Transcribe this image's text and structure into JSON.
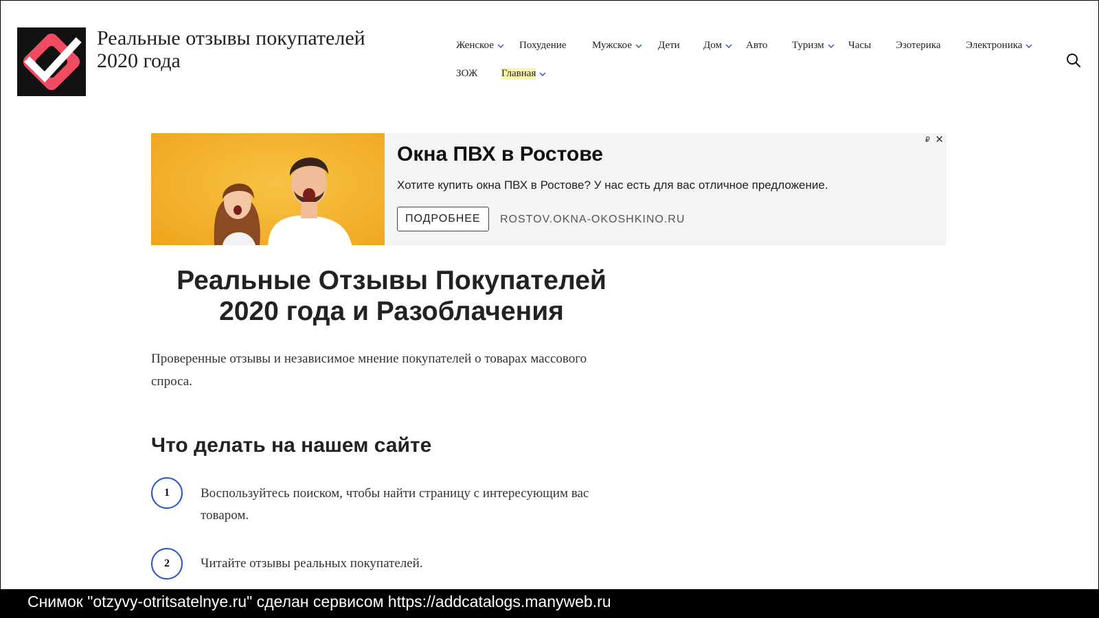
{
  "header": {
    "logo_icon": "checkmark-logo",
    "site_title_line1": "Реальные отзывы покупателей",
    "site_title_line2": "2020 года",
    "search_icon": "search-icon"
  },
  "nav": {
    "items": [
      {
        "label": "Женское",
        "has_dropdown": true
      },
      {
        "label": "Похудение",
        "has_dropdown": false
      },
      {
        "label": "Мужское",
        "has_dropdown": true
      },
      {
        "label": "Дети",
        "has_dropdown": false
      },
      {
        "label": "Дом",
        "has_dropdown": true
      },
      {
        "label": "Авто",
        "has_dropdown": false
      },
      {
        "label": "Туризм",
        "has_dropdown": true
      },
      {
        "label": "Часы",
        "has_dropdown": false
      },
      {
        "label": "Эзотерика",
        "has_dropdown": false
      },
      {
        "label": "Электроника",
        "has_dropdown": true
      },
      {
        "label": "ЗОЖ",
        "has_dropdown": false
      },
      {
        "label": "Главная",
        "has_dropdown": true,
        "highlighted": true
      }
    ]
  },
  "ad": {
    "title": "Окна ПВХ в Ростове",
    "text": "Хотите купить окна ПВХ в Ростове? У нас есть для вас отличное предложение.",
    "button_label": "ПОДРОБНЕЕ",
    "domain": "ROSTOV.OKNA-OKOSHKINO.RU",
    "mark": "₽",
    "close": "✕"
  },
  "main": {
    "heading_line1": "Реальные Отзывы Покупателей",
    "heading_line2": "2020 года и Разоблачения",
    "intro": "Проверенные отзывы и независимое мнение покупателей о товарах массового спроса.",
    "section_heading": "Что делать на нашем сайте",
    "steps": [
      {
        "num": "1",
        "text": "Воспользуйтесь поиском, чтобы найти страницу с интересующим вас товаром."
      },
      {
        "num": "2",
        "text": "Читайте отзывы реальных покупателей."
      }
    ]
  },
  "caption": "Снимок \"otzyvy-otritsatelnye.ru\" сделан сервисом https://addcatalogs.manyweb.ru",
  "colors": {
    "accent_blue": "#2c52c6",
    "logo_pink": "#f04b63",
    "ad_banner_yellow": "#f6b321",
    "highlight": "#fbf6a7"
  }
}
